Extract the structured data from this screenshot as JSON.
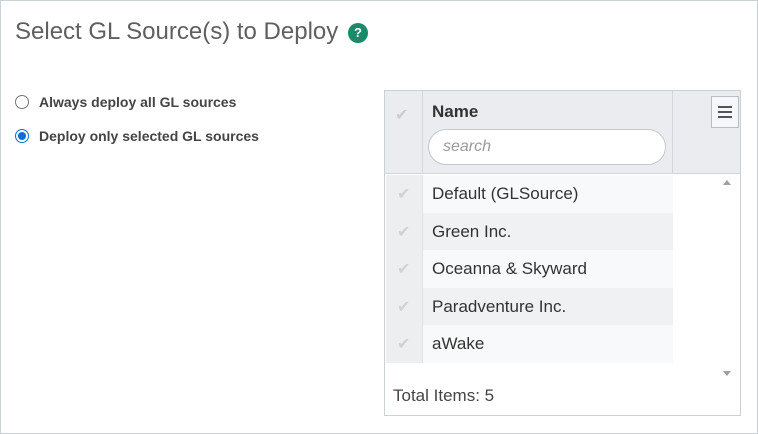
{
  "page": {
    "title": "Select GL Source(s) to Deploy",
    "help_icon": "?"
  },
  "options": [
    {
      "label": "Always deploy all GL sources",
      "checked": false
    },
    {
      "label": "Deploy only selected GL sources",
      "checked": true
    }
  ],
  "grid": {
    "column_header": "Name",
    "search_placeholder": "search",
    "menu_icon": "hamburger-menu-icon",
    "check_icon": "✔",
    "rows": [
      {
        "name": "Default (GLSource)"
      },
      {
        "name": "Green Inc."
      },
      {
        "name": "Oceanna & Skyward"
      },
      {
        "name": "Paradventure Inc."
      },
      {
        "name": "aWake"
      }
    ],
    "footer_label": "Total Items: 5"
  },
  "colors": {
    "help_badge": "#1a8a6a",
    "radio_selected": "#0b6fd8"
  }
}
